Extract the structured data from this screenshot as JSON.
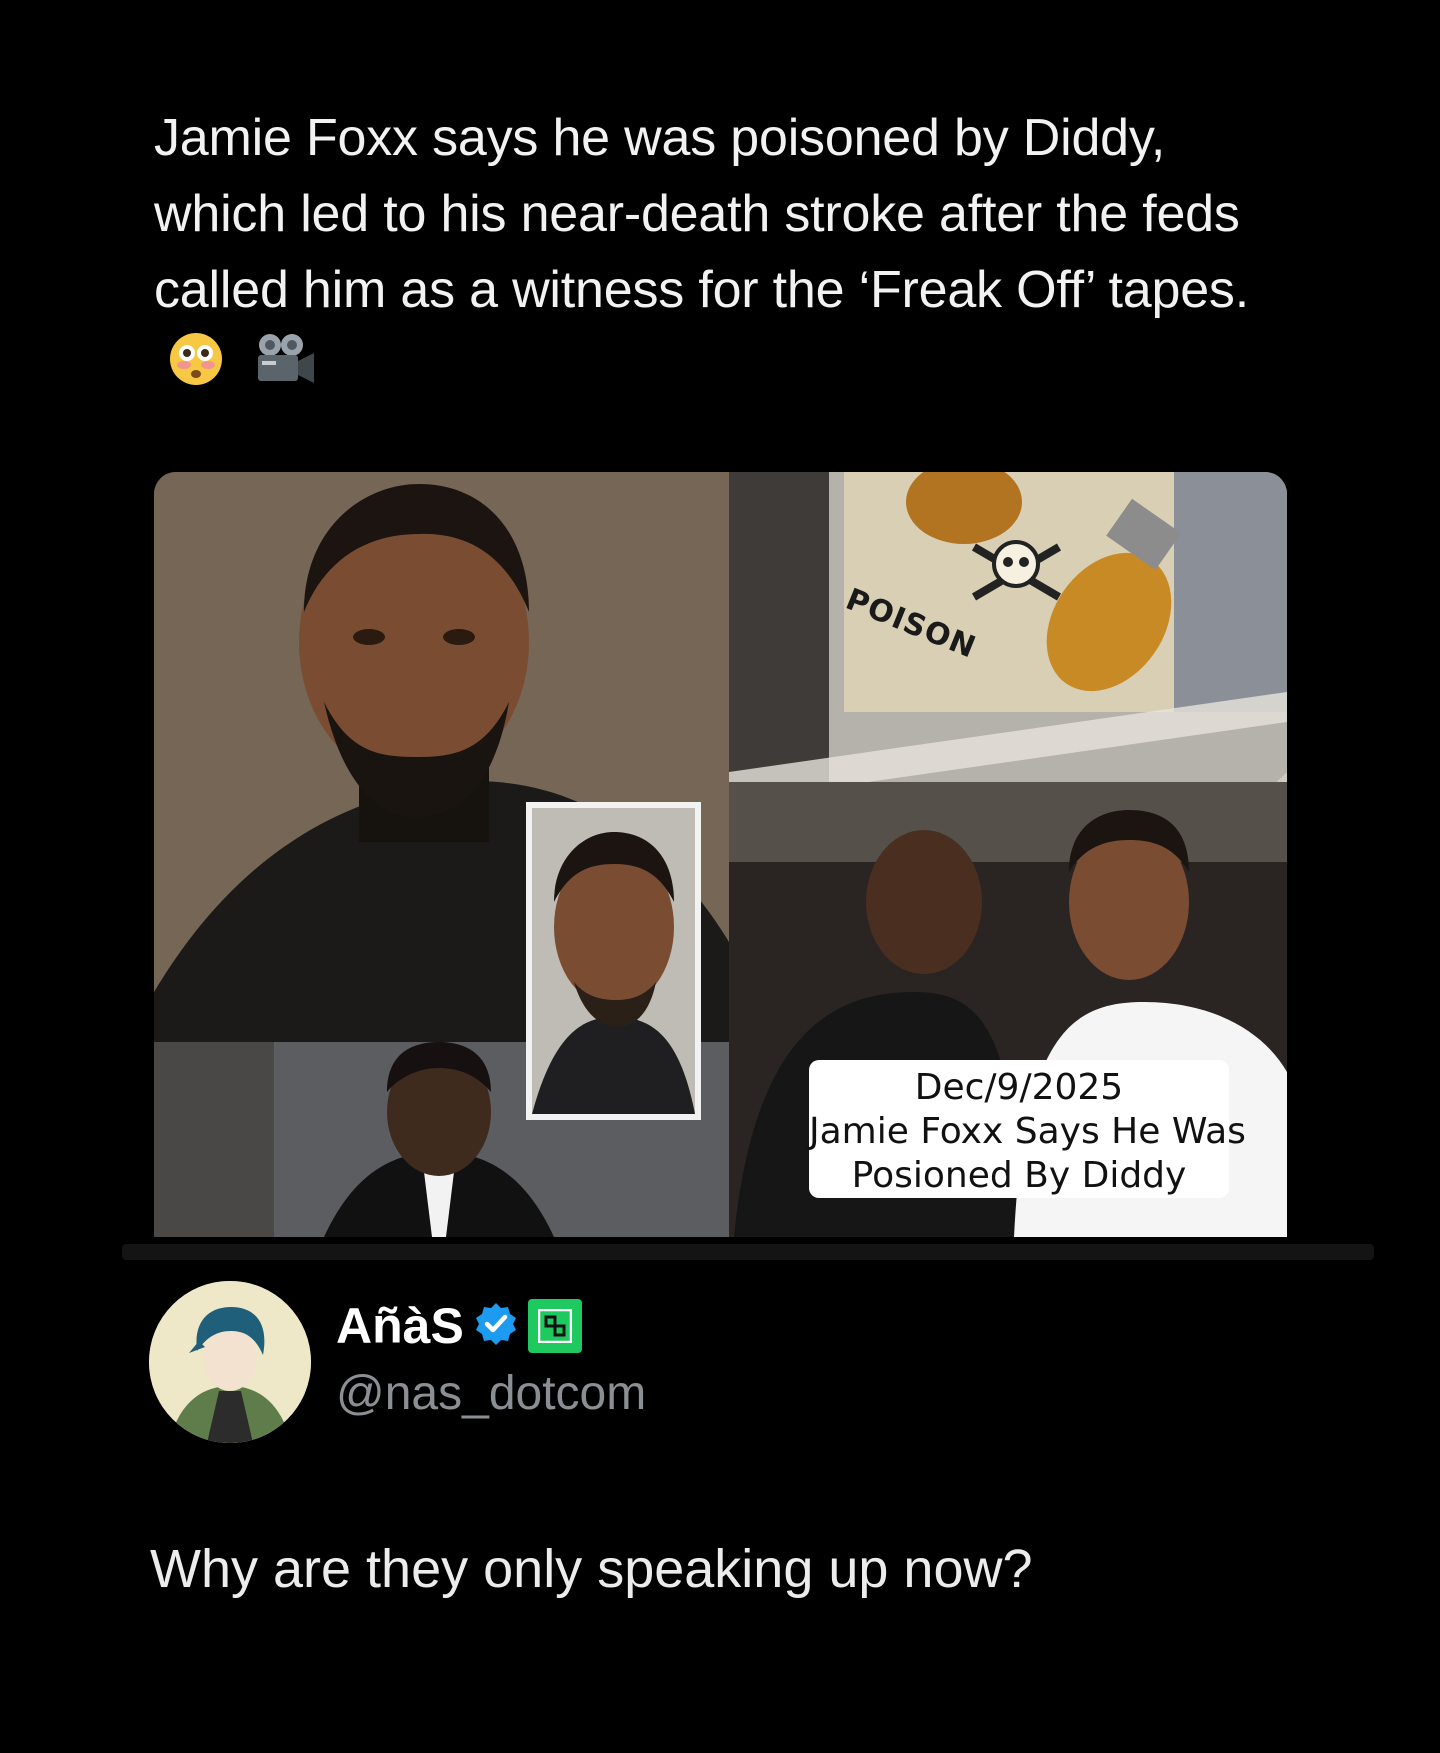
{
  "post": {
    "text": "Jamie Foxx says he was poisoned by Diddy, which led to his near-death stroke after the feds called him as a witness for the ‘Freak Off’ tapes.",
    "emojis": [
      "flushed-face-icon",
      "movie-camera-icon"
    ]
  },
  "media": {
    "label_poison": "POISON",
    "caption": {
      "date": "Dec/9/2025",
      "line1": "Jamie Foxx Says He Was",
      "line2": "Posioned By Diddy"
    }
  },
  "author": {
    "display_name": "AñàS",
    "handle": "@nas_dotcom",
    "verified_color": "#1d9bf0",
    "badge_color": "#1ec95f"
  },
  "reply": {
    "text": "Why are they only speaking up now?"
  }
}
